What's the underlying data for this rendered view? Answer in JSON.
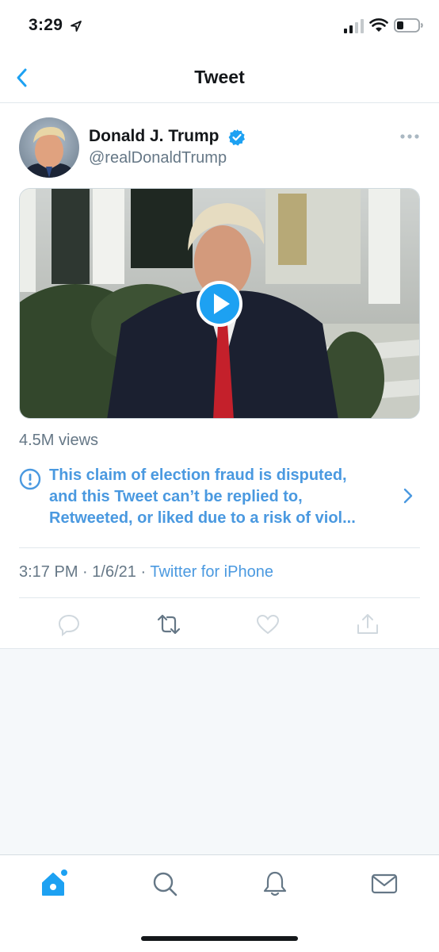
{
  "status_bar": {
    "time": "3:29",
    "icons": [
      "location-arrow-icon",
      "cellular-signal-icon",
      "wifi-icon",
      "battery-icon"
    ]
  },
  "nav": {
    "title": "Tweet",
    "back_icon": "chevron-left-icon"
  },
  "tweet": {
    "author_name": "Donald J. Trump",
    "author_handle": "@realDonaldTrump",
    "verified_icon": "verified-badge-icon",
    "more_icon": "more-dots-icon",
    "media_type": "video",
    "views": "4.5M views",
    "notice": {
      "icon": "exclamation-circle-icon",
      "line1": "This claim of election fraud is disputed,",
      "line2": "and this Tweet can’t be replied to,",
      "line3": "Retweeted, or liked due to a risk of viol..."
    },
    "time": "3:17 PM",
    "date": "1/6/21",
    "separator": "·",
    "source": "Twitter for iPhone",
    "actions": [
      "reply-icon",
      "retweet-icon",
      "like-icon",
      "share-icon"
    ]
  },
  "tab_bar": {
    "tabs": [
      "home-icon",
      "search-icon",
      "notifications-icon",
      "messages-icon"
    ]
  },
  "colors": {
    "accent": "#1da1f2",
    "link": "#4a99e0",
    "secondary_text": "#657786",
    "divider": "#e1e8ed",
    "empty_background": "#f5f8fa"
  }
}
